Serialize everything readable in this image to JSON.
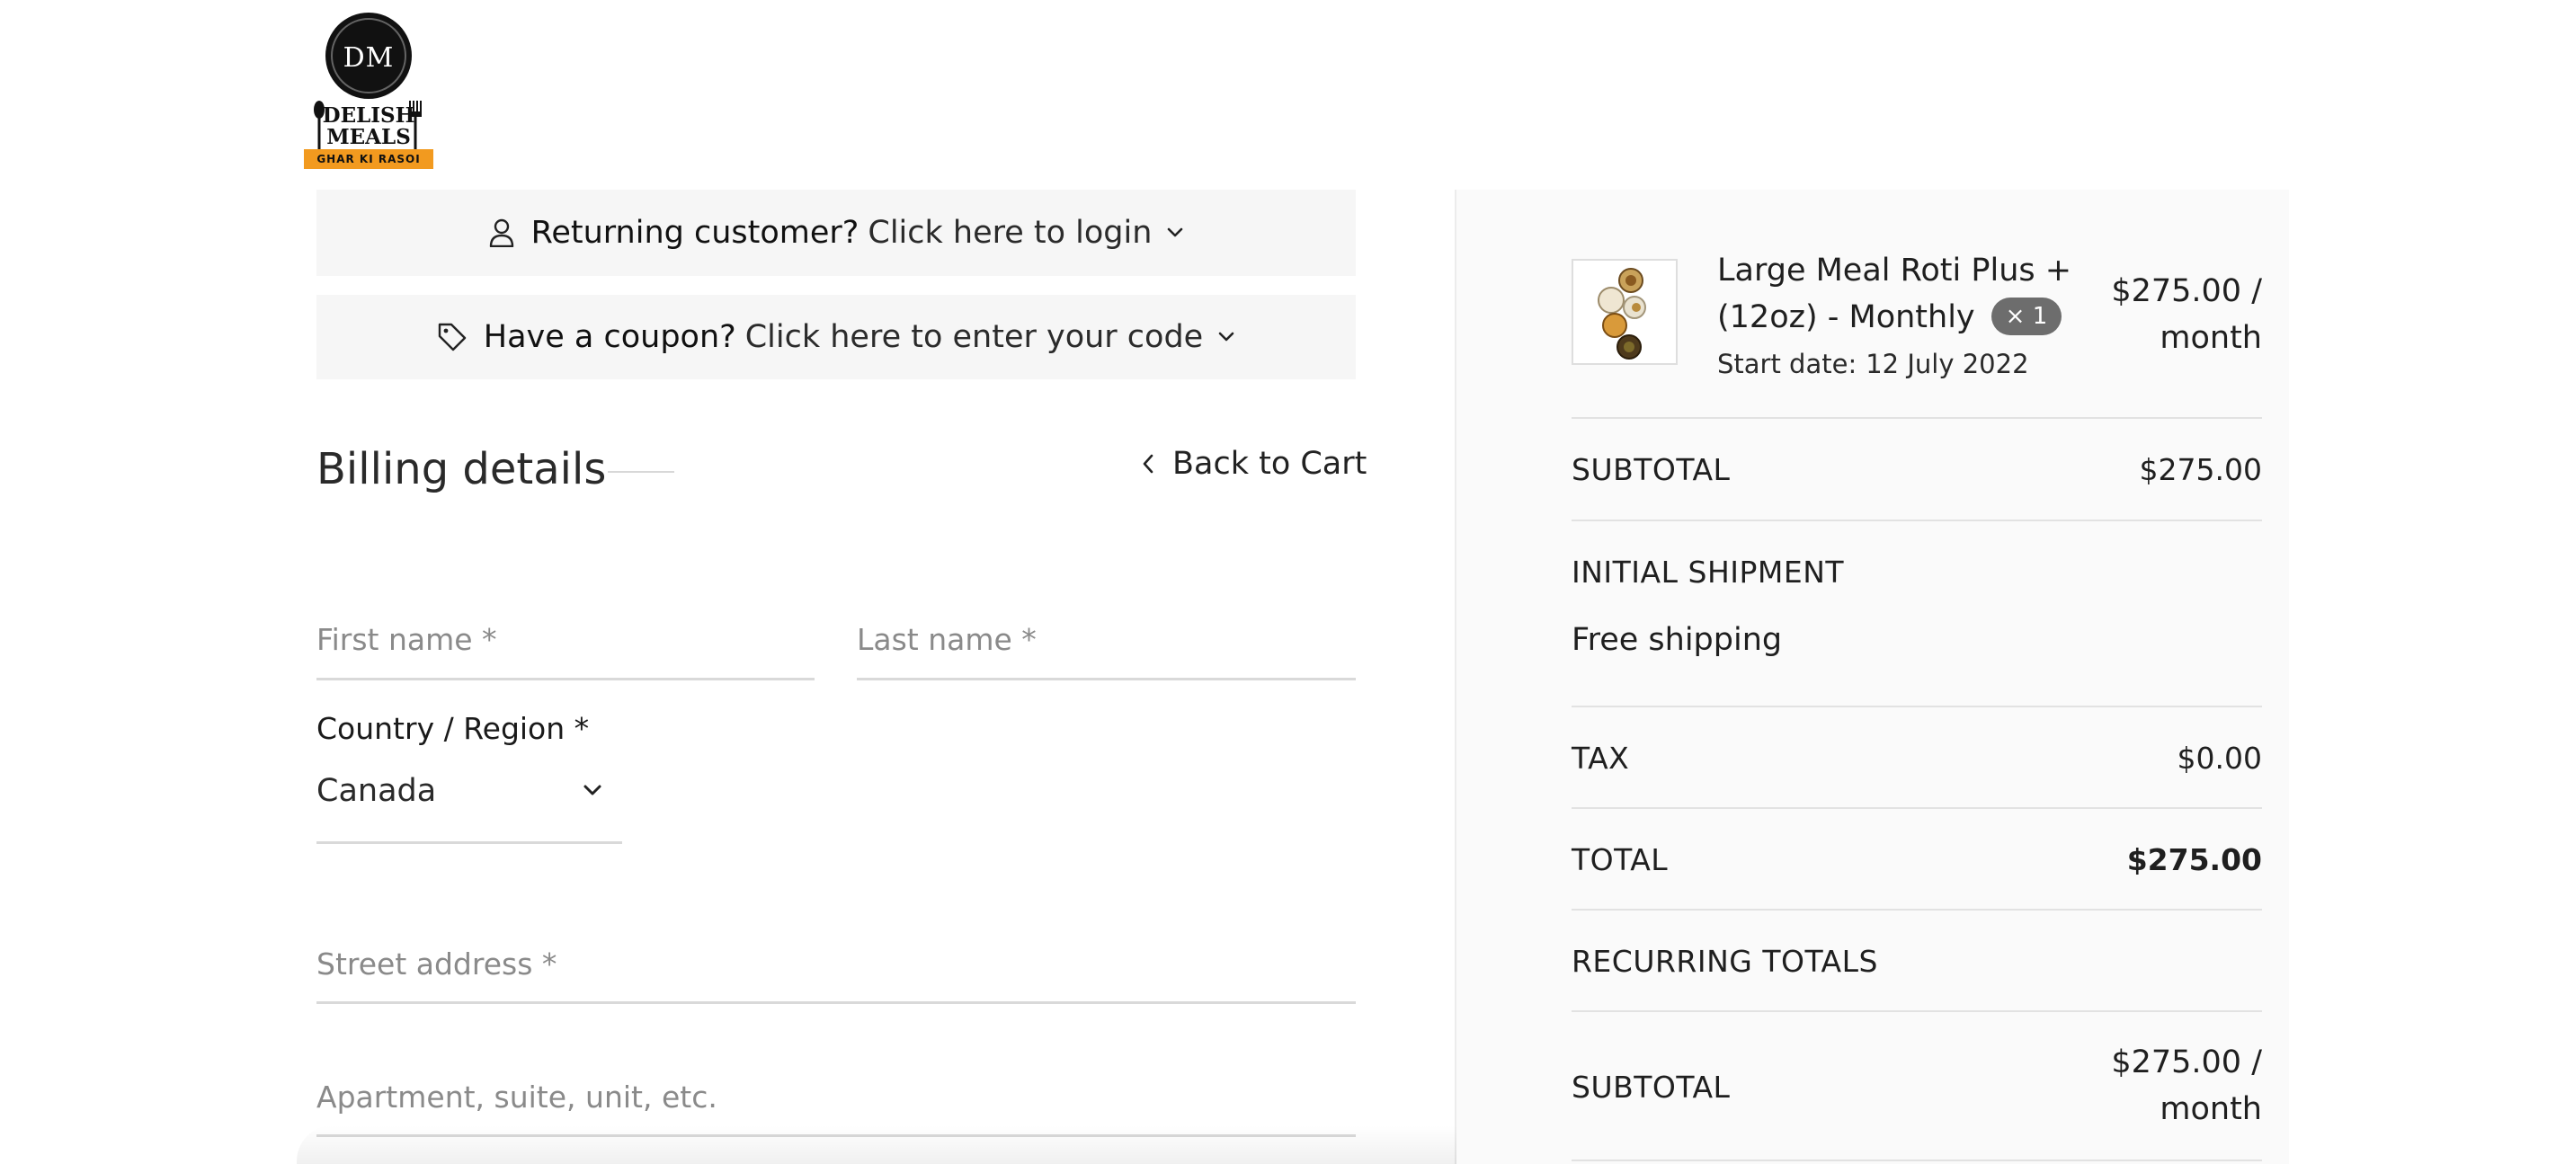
{
  "logo": {
    "monogram": "DM",
    "line1": "DELISH",
    "line2": "MEALS",
    "banner": "GHAR KI RASOI",
    "banner_color": "#f29a1f"
  },
  "toggles": {
    "login": {
      "icon": "user-icon",
      "lead": "Returning customer?",
      "link": "Click here to login"
    },
    "coupon": {
      "icon": "tag-icon",
      "lead": "Have a coupon?",
      "link": "Click here to enter your code"
    }
  },
  "billing": {
    "title": "Billing details",
    "back_to_cart": "Back to Cart",
    "first_name_placeholder": "First name *",
    "last_name_placeholder": "Last name *",
    "country_label": "Country / Region *",
    "country_value": "Canada",
    "street_placeholder": "Street address *",
    "apartment_placeholder": "Apartment, suite, unit, etc."
  },
  "order": {
    "product_name": "Large Meal Roti Plus + (12oz) - Monthly",
    "quantity": "× 1",
    "start_date_label": "Start date:",
    "start_date_value": "12 July 2022",
    "price_line1": "$275.00 /",
    "price_line2": "month",
    "subtotal_label": "SUBTOTAL",
    "subtotal_value": "$275.00",
    "shipment_label": "INITIAL SHIPMENT",
    "shipment_value": "Free shipping",
    "tax_label": "TAX",
    "tax_value": "$0.00",
    "total_label": "TOTAL",
    "total_value": "$275.00",
    "recurring_label": "RECURRING TOTALS",
    "recurring_subtotal_label": "SUBTOTAL",
    "recurring_subtotal_line1": "$275.00 /",
    "recurring_subtotal_line2": "month"
  }
}
